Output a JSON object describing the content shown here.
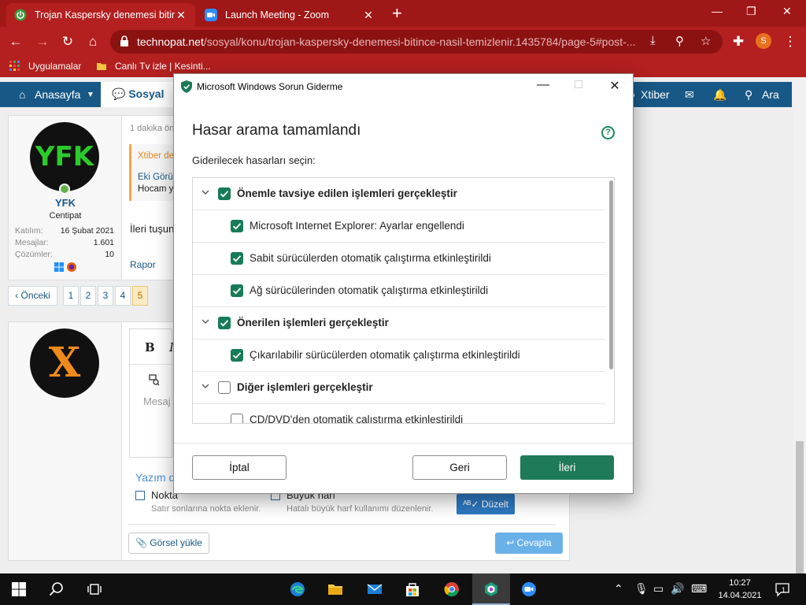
{
  "browser": {
    "tabs": [
      {
        "title": "Trojan Kaspersky denemesi bitince",
        "active": true
      },
      {
        "title": "Launch Meeting - Zoom",
        "active": false
      }
    ],
    "url_host": "technopat.net",
    "url_path": "/sosyal/konu/trojan-kaspersky-denemesi-bitince-nasil-temizlenir.1435784/page-5#post-...",
    "profile_initial": "S",
    "bookmarks": [
      "Uygulamalar",
      "Canlı Tv izle | Kesinti..."
    ]
  },
  "site": {
    "nav": {
      "home": "Anasayfa",
      "social": "Sosyal",
      "xtiber": "Xtiber",
      "search": "Ara"
    },
    "post1": {
      "avatar_text": "YFK",
      "username": "YFK",
      "user_title": "Centipat",
      "stats": [
        {
          "key": "Katılım:",
          "value": "16 Şubat 2021"
        },
        {
          "key": "Mesajlar:",
          "value": "1.601"
        },
        {
          "key": "Çözümler:",
          "value": "10"
        }
      ],
      "time": "1 dakika ön",
      "quote_author": "Xtiber de",
      "quote_link": "Eki Görü",
      "quote_text": "Hocam y",
      "body": "İleri tuşun",
      "report": "Rapor"
    },
    "pagination": {
      "prev": "‹ Önceki",
      "pages": [
        "1",
        "2",
        "3",
        "4",
        "5"
      ],
      "current": "5"
    },
    "post2": {
      "avatar_text": "X",
      "editor_bold": "B",
      "editor_italic": "I",
      "editor_placeholder": "Mesaj",
      "spell_title": "Yazım d",
      "opt1_label": "Nokta",
      "opt1_desc": "Satır sonlarına nokta eklenir.",
      "opt2_label": "Büyük harf",
      "opt2_desc": "Hatalı büyük harf kullanımı düzenlenir.",
      "fix_label": "Düzelt",
      "upload_label": "Görsel yükle",
      "reply_label": "Cevapla"
    }
  },
  "dialog": {
    "title": "Microsoft Windows Sorun Giderme",
    "heading": "Hasar arama tamamlandı",
    "help": "?",
    "subtitle": "Giderilecek hasarları seçin:",
    "rows": [
      {
        "label": "Önemle tavsiye edilen işlemleri gerçekleştir",
        "group": true,
        "checked": true
      },
      {
        "label": "Microsoft Internet Explorer: Ayarlar engellendi",
        "group": false,
        "checked": true
      },
      {
        "label": "Sabit sürücülerden otomatik çalıştırma etkinleştirildi",
        "group": false,
        "checked": true
      },
      {
        "label": "Ağ sürücülerinden otomatik çalıştırma etkinleştirildi",
        "group": false,
        "checked": true
      },
      {
        "label": "Önerilen işlemleri gerçekleştir",
        "group": true,
        "checked": true
      },
      {
        "label": "Çıkarılabilir sürücülerden otomatik çalıştırma etkinleştirildi",
        "group": false,
        "checked": true
      },
      {
        "label": "Diğer işlemleri gerçekleştir",
        "group": true,
        "checked": false
      },
      {
        "label": "CD/DVD'den otomatik çalıştırma etkinleştirildi",
        "group": false,
        "checked": false
      }
    ],
    "buttons": {
      "cancel": "İptal",
      "back": "Geri",
      "next": "İleri"
    }
  },
  "taskbar": {
    "time": "10:27",
    "date": "14.04.2021",
    "notification_count": "1"
  },
  "colors": {
    "chrome_tab_strip": "#a01717",
    "chrome_toolbar": "#b41f1f",
    "site_nav": "#185886",
    "dialog_accent": "#187b57"
  }
}
